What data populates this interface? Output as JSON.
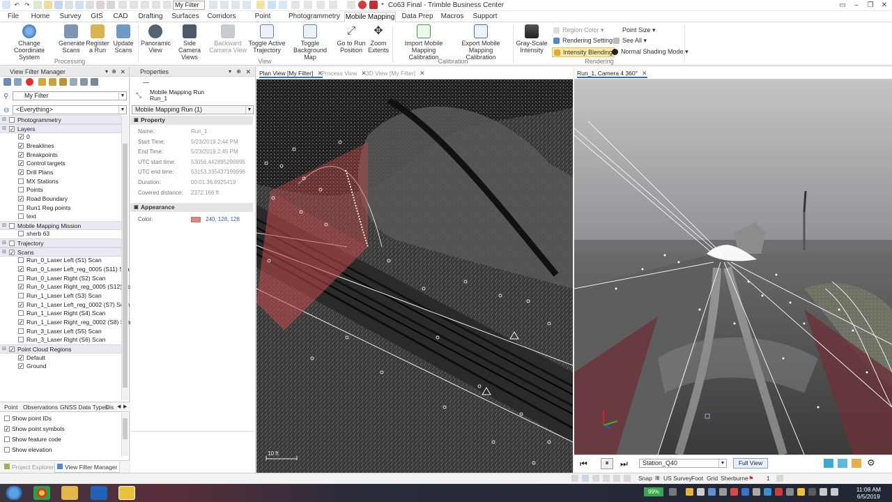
{
  "titlebar": {
    "filter_value": "My Filter",
    "title": "Co63 Final - Trimble Business Center"
  },
  "menu": {
    "tabs": [
      "File",
      "Home",
      "Survey",
      "GIS",
      "CAD",
      "Drafting",
      "Surfaces",
      "Corridors",
      "Point Clouds",
      "Photogrammetry",
      "Mobile Mapping",
      "Data Prep",
      "Macros",
      "Support"
    ],
    "active": "Mobile Mapping"
  },
  "ribbon": {
    "processing": {
      "group_label": "Processing",
      "buttons": [
        "Change Coordinate System",
        "Generate Scans",
        "Register a Run",
        "Update Scans"
      ]
    },
    "view": {
      "group_label": "View",
      "buttons": [
        "Panoramic View",
        "Side Camera Views",
        "Backward Camera View",
        "Toggle Active Trajectory",
        "Toggle Background Map",
        "Go to Run Position",
        "Zoom Extents"
      ]
    },
    "calibration": {
      "group_label": "Calibration",
      "buttons": [
        "Import Mobile Mapping Calibration",
        "Export Mobile Mapping Calibration"
      ]
    },
    "rendering": {
      "group_label": "Rendering",
      "grayscale": "Gray-Scale Intensity",
      "region_color": "Region Color",
      "point_size": "Point Size",
      "rendering_settings": "Rendering Settings",
      "see_all": "See All",
      "intensity_blending": "Intensity Blending",
      "normal_shading": "Normal Shading Mode"
    }
  },
  "left_panel": {
    "title": "View Filter Manager",
    "filter": "My Filter",
    "scope": "<Everything>",
    "tree": [
      {
        "label": "Photogrammetry",
        "group": true,
        "checked": false
      },
      {
        "label": "Layers",
        "group": true,
        "checked": true
      },
      {
        "label": "0",
        "checked": true
      },
      {
        "label": "Breaklines",
        "checked": true
      },
      {
        "label": "Breakpoints",
        "checked": true
      },
      {
        "label": "Control targets",
        "checked": true
      },
      {
        "label": "Drill Plans",
        "checked": true
      },
      {
        "label": "MX Stations",
        "checked": false
      },
      {
        "label": "Points",
        "checked": false
      },
      {
        "label": "Road Boundary",
        "checked": true
      },
      {
        "label": "Run1 Reg points",
        "checked": false
      },
      {
        "label": "text",
        "checked": false
      },
      {
        "label": "Mobile Mapping Mission",
        "group": true,
        "checked": false
      },
      {
        "label": "sherb 63",
        "checked": false
      },
      {
        "label": "Trajectory",
        "group": true,
        "checked": false
      },
      {
        "label": "Scans",
        "group": true,
        "checked": true
      },
      {
        "label": "Run_0_Laser Left (S1) Scan",
        "checked": false
      },
      {
        "label": "Run_0_Laser Left_reg_0005 (S11) Sca",
        "checked": true
      },
      {
        "label": "Run_0_Laser Right (S2) Scan",
        "checked": false
      },
      {
        "label": "Run_0_Laser Right_reg_0005 (S12) Sc",
        "checked": true
      },
      {
        "label": "Run_1_Laser Left (S3) Scan",
        "checked": false
      },
      {
        "label": "Run_1_Laser Left_reg_0002 (S7) Scan",
        "checked": true
      },
      {
        "label": "Run_1_Laser Right (S4) Scan",
        "checked": false
      },
      {
        "label": "Run_1_Laser Right_reg_0002 (S8) Sca",
        "checked": true
      },
      {
        "label": "Run_3_Laser Left (S5) Scan",
        "checked": false
      },
      {
        "label": "Run_3_Laser Right (S6) Scan",
        "checked": false
      },
      {
        "label": "Point Cloud Regions",
        "group": true,
        "checked": true
      },
      {
        "label": "Default",
        "checked": true
      },
      {
        "label": "Ground",
        "checked": true
      }
    ],
    "bottom_tabs": [
      "Point",
      "Observations",
      "GNSS Data Types",
      "Dis"
    ],
    "options": [
      {
        "label": "Show point IDs",
        "checked": false
      },
      {
        "label": "Show point symbols",
        "checked": true
      },
      {
        "label": "Show feature code",
        "checked": false
      },
      {
        "label": "Show elevation",
        "checked": false
      }
    ],
    "footer_tabs": [
      "Project Explorer",
      "View Filter Manager"
    ]
  },
  "properties": {
    "title": "Properties",
    "object_title": "Mobile Mapping Run",
    "object_name": "Run_1",
    "selector": "Mobile Mapping Run (1)",
    "section_property": "Property",
    "rows": [
      {
        "k": "Name:",
        "v": "Run_1"
      },
      {
        "k": "Start Time:",
        "v": "5/23/2019 2:44 PM"
      },
      {
        "k": "End Time:",
        "v": "5/23/2019 2:45 PM"
      },
      {
        "k": "UTC start time:",
        "v": "53056.442895299995"
      },
      {
        "k": "UTC end time:",
        "v": "53153.335437199996"
      },
      {
        "k": "Duration:",
        "v": "00:01:36.8925419"
      },
      {
        "k": "Covered distance:",
        "v": "2372.166 ft"
      }
    ],
    "section_appearance": "Appearance",
    "color_label": "Color:",
    "color_value": "240, 128, 128",
    "color_hex": "#f08080"
  },
  "plan_tabs": [
    {
      "label": "Plan View [My Filter]",
      "active": true
    },
    {
      "label": "Process View",
      "active": false
    },
    {
      "label": "3D View [My Filter]",
      "active": false
    }
  ],
  "plan_scale": "10 ft",
  "camera_tab": "Run_1, Camera 4 360°",
  "camera_controls": {
    "station": "Station_Q40",
    "full_view": "Full View"
  },
  "status": {
    "snap": "Snap",
    "units": "US Survey",
    "foot": "Foot",
    "grid": "Grid",
    "place": "Sherburne",
    "count": "1"
  },
  "taskbar": {
    "battery": "99%",
    "time": "11:08 AM",
    "date": "6/5/2019"
  }
}
